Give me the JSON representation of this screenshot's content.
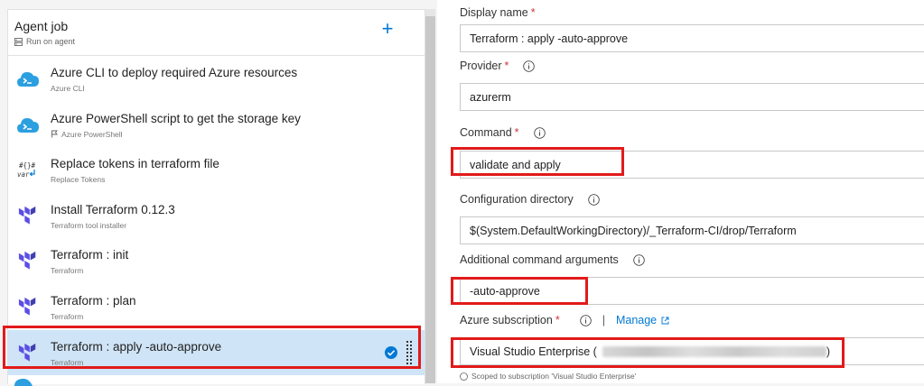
{
  "job": {
    "title": "Agent job",
    "subtitle": "Run on agent"
  },
  "tasks": [
    {
      "name": "Azure CLI to deploy required Azure resources",
      "sub": "Azure CLI",
      "icon": "azure-cli-icon"
    },
    {
      "name": "Azure PowerShell script to get the storage key",
      "sub": "Azure PowerShell",
      "icon": "azure-powershell-icon"
    },
    {
      "name": "Replace tokens in terraform file",
      "sub": "Replace Tokens",
      "icon": "replace-tokens-icon"
    },
    {
      "name": "Install Terraform 0.12.3",
      "sub": "Terraform tool installer",
      "icon": "terraform-icon"
    },
    {
      "name": "Terraform : init",
      "sub": "Terraform",
      "icon": "terraform-icon"
    },
    {
      "name": "Terraform : plan",
      "sub": "Terraform",
      "icon": "terraform-icon"
    },
    {
      "name": "Terraform : apply -auto-approve",
      "sub": "Terraform",
      "icon": "terraform-icon",
      "selected": true
    }
  ],
  "form": {
    "display_name": {
      "label": "Display name",
      "value": "Terraform : apply -auto-approve"
    },
    "provider": {
      "label": "Provider",
      "value": "azurerm"
    },
    "command": {
      "label": "Command",
      "value": "validate and apply"
    },
    "config_dir": {
      "label": "Configuration directory",
      "value": "$(System.DefaultWorkingDirectory)/_Terraform-CI/drop/Terraform"
    },
    "additional_args": {
      "label": "Additional command arguments",
      "value": "-auto-approve"
    },
    "subscription": {
      "label": "Azure subscription",
      "separator": "|",
      "manage_label": "Manage",
      "value_prefix": "Visual Studio Enterprise (",
      "value_suffix": ")",
      "scoped_note": "Scoped to subscription 'Visual Studio Enterprise'"
    },
    "required_marker": "*"
  },
  "colors": {
    "accent": "#0078d4",
    "highlight_box": "#e21a1a",
    "selected_row": "#cfe4f6",
    "terraform_purple": "#5c4ee5"
  }
}
